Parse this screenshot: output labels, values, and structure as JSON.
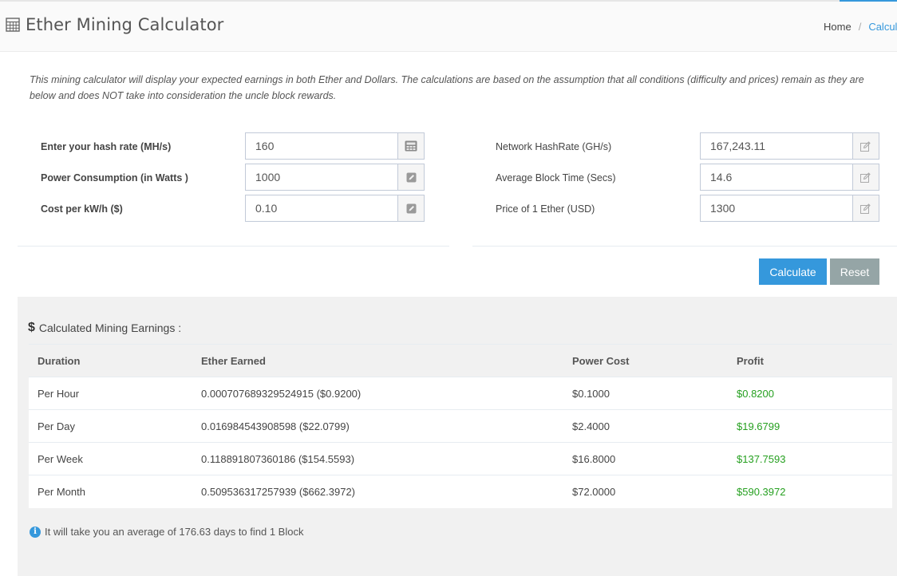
{
  "header": {
    "title": "Ether Mining Calculator",
    "breadcrumb": {
      "home": "Home",
      "separator": "/",
      "current": "Calcul"
    }
  },
  "intro": "This mining calculator will display your expected earnings in both Ether and Dollars. The calculations are based on the assumption that all conditions (difficulty and prices) remain as they are below and does NOT take into consideration the uncle block rewards.",
  "left_fields": [
    {
      "label": "Enter your hash rate (MH/s)",
      "value": "160",
      "icon": "calculator-icon"
    },
    {
      "label": "Power Consumption (in Watts )",
      "value": "1000",
      "icon": "edit-icon"
    },
    {
      "label": "Cost per kW/h ($)",
      "value": "0.10",
      "icon": "edit-icon"
    }
  ],
  "right_fields": [
    {
      "label": "Network HashRate (GH/s)",
      "value": "167,243.11",
      "icon": "edit-icon"
    },
    {
      "label": "Average Block Time (Secs)",
      "value": "14.6",
      "icon": "edit-icon"
    },
    {
      "label": "Price of 1 Ether (USD)",
      "value": "1300",
      "icon": "edit-icon"
    }
  ],
  "buttons": {
    "calculate": "Calculate",
    "reset": "Reset"
  },
  "results": {
    "icon": "$",
    "title": "Calculated Mining Earnings :",
    "columns": [
      "Duration",
      "Ether Earned",
      "Power Cost",
      "Profit"
    ],
    "rows": [
      {
        "duration": "Per Hour",
        "ether": "0.000707689329524915 ($0.9200)",
        "power": "$0.1000",
        "profit": "$0.8200"
      },
      {
        "duration": "Per Day",
        "ether": "0.016984543908598 ($22.0799)",
        "power": "$2.4000",
        "profit": "$19.6799"
      },
      {
        "duration": "Per Week",
        "ether": "0.118891807360186 ($154.5593)",
        "power": "$16.8000",
        "profit": "$137.7593"
      },
      {
        "duration": "Per Month",
        "ether": "0.509536317257939 ($662.3972)",
        "power": "$72.0000",
        "profit": "$590.3972"
      }
    ],
    "info_icon": "i",
    "info": "It will take you an average of 176.63 days to find 1 Block"
  },
  "colors": {
    "accent": "#3598dc",
    "reset": "#95a5a6",
    "profit": "#26a020",
    "panel": "#f1f1f1"
  }
}
